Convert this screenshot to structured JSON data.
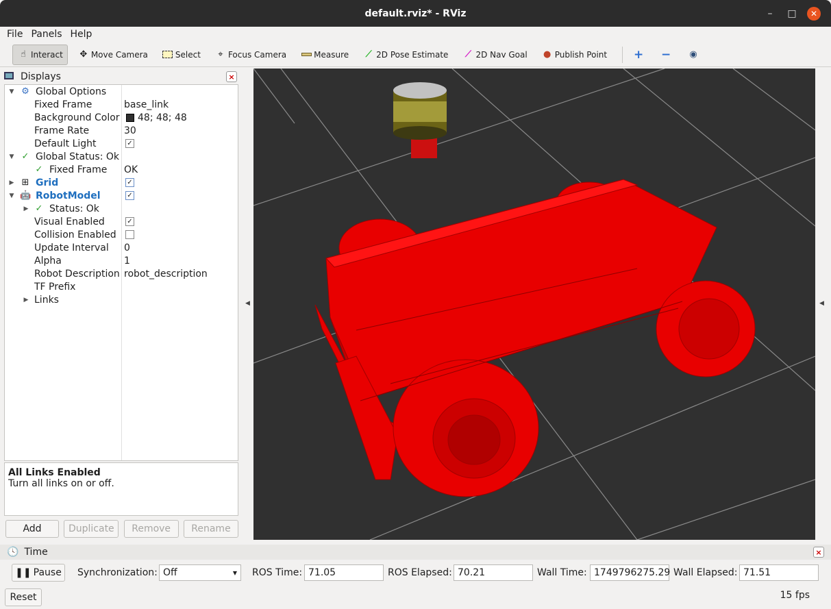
{
  "window": {
    "title": "default.rviz* - RViz",
    "minimize": "–",
    "maximize": "□",
    "close": "✕"
  },
  "menu": [
    "File",
    "Panels",
    "Help"
  ],
  "toolbar": {
    "interact": "Interact",
    "move_camera": "Move Camera",
    "select": "Select",
    "focus_camera": "Focus Camera",
    "measure": "Measure",
    "pose_estimate": "2D Pose Estimate",
    "nav_goal": "2D Nav Goal",
    "publish_point": "Publish Point"
  },
  "displays": {
    "title": "Displays",
    "close": "×",
    "tree": {
      "global_options": "Global Options",
      "fixed_frame_label": "Fixed Frame",
      "fixed_frame_value": "base_link",
      "bg_color_label": "Background Color",
      "bg_color_value": "48; 48; 48",
      "frame_rate_label": "Frame Rate",
      "frame_rate_value": "30",
      "default_light_label": "Default Light",
      "global_status": "Global Status: Ok",
      "gs_fixed_frame_label": "Fixed Frame",
      "gs_fixed_frame_value": "OK",
      "grid": "Grid",
      "robot_model": "RobotModel",
      "status_ok": "Status: Ok",
      "visual_enabled": "Visual Enabled",
      "collision_enabled": "Collision Enabled",
      "update_interval_label": "Update Interval",
      "update_interval_value": "0",
      "alpha_label": "Alpha",
      "alpha_value": "1",
      "robot_desc_label": "Robot Description",
      "robot_desc_value": "robot_description",
      "tf_prefix_label": "TF Prefix",
      "links": "Links"
    },
    "description": {
      "title": "All Links Enabled",
      "text": "Turn all links on or off."
    },
    "buttons": {
      "add": "Add",
      "duplicate": "Duplicate",
      "remove": "Remove",
      "rename": "Rename"
    }
  },
  "time": {
    "title": "Time",
    "pause": "Pause",
    "sync_label": "Synchronization:",
    "sync_value": "Off",
    "ros_time_label": "ROS Time:",
    "ros_time": "71.05",
    "ros_elapsed_label": "ROS Elapsed:",
    "ros_elapsed": "70.21",
    "wall_time_label": "Wall Time:",
    "wall_time": "1749796275.29",
    "wall_elapsed_label": "Wall Elapsed:",
    "wall_elapsed": "71.51",
    "reset": "Reset",
    "fps": "15 fps"
  },
  "colors": {
    "background": "#303030",
    "robot": "#e00000",
    "accent": "#e95420"
  }
}
